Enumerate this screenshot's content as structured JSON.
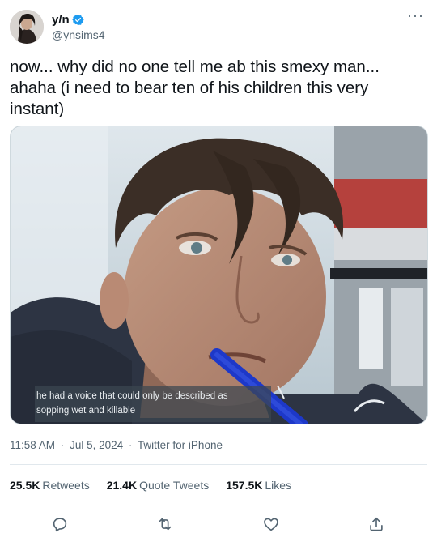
{
  "user": {
    "display_name": "y/n",
    "handle": "@ynsims4",
    "verified": true,
    "avatar_icon": "avatar-photo"
  },
  "more_icon": "more-icon",
  "tweet": {
    "text": "now... why did no one tell me ab this smexy man... ahaha (i need to bear ten of his children this very instant)"
  },
  "media": {
    "caption_lines": [
      "he had a voice that could only be described as",
      "sopping wet and killable"
    ]
  },
  "meta": {
    "time": "11:58 AM",
    "separator": "·",
    "date": "Jul 5, 2024",
    "source": "Twitter for iPhone"
  },
  "stats": {
    "retweets_count": "25.5K",
    "retweets_label": "Retweets",
    "quote_count": "21.4K",
    "quote_label": "Quote Tweets",
    "likes_count": "157.5K",
    "likes_label": "Likes"
  },
  "actions": [
    "reply-icon",
    "retweet-icon",
    "like-icon",
    "share-icon"
  ],
  "colors": {
    "verified": "#1d9bf0",
    "text": "#0f1419",
    "muted": "#536471",
    "divider": "#e1e8ed"
  }
}
